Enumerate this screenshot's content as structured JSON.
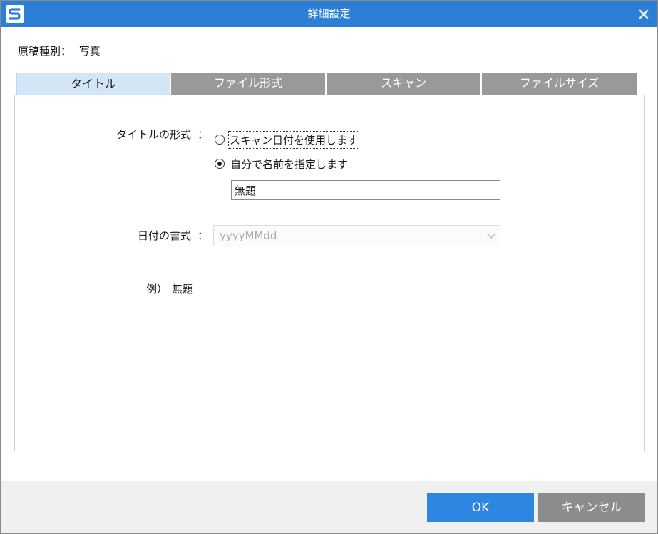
{
  "window": {
    "title": "詳細設定",
    "accent_color": "#2b7fd6",
    "logo_icon": "app-logo-icon",
    "close_icon": "close-icon"
  },
  "document_type": {
    "label": "原稿種別：",
    "value": "写真"
  },
  "tabs": [
    {
      "label": "タイトル",
      "active": true
    },
    {
      "label": "ファイル形式",
      "active": false
    },
    {
      "label": "スキャン",
      "active": false
    },
    {
      "label": "ファイルサイズ",
      "active": false
    }
  ],
  "title_settings": {
    "format_label": "タイトルの形式",
    "colon": "：",
    "options": [
      {
        "label": "スキャン日付を使用します",
        "checked": false
      },
      {
        "label": "自分で名前を指定します",
        "checked": true
      }
    ],
    "name_value": "無題"
  },
  "date_format": {
    "label": "日付の書式",
    "colon": "：",
    "value": "yyyyMMdd",
    "disabled": true
  },
  "example": {
    "label": "例）",
    "value": "無題"
  },
  "buttons": {
    "ok": "OK",
    "cancel": "キャンセル"
  }
}
